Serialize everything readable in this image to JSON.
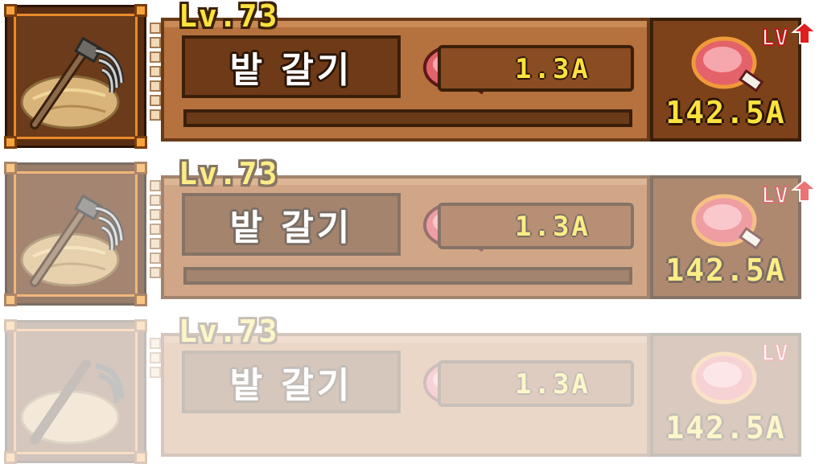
{
  "rows": [
    {
      "level": "Lv.73",
      "name": "밭 갈기",
      "cost": "1.3A",
      "reward": "142.5A",
      "badge": "LV",
      "progress": 0
    },
    {
      "level": "Lv.73",
      "name": "밭 갈기",
      "cost": "1.3A",
      "reward": "142.5A",
      "badge": "LV",
      "progress": 0
    },
    {
      "level": "Lv.73",
      "name": "밭 갈기",
      "cost": "1.3A",
      "reward": "142.5A",
      "badge": "LV",
      "progress": 0
    }
  ],
  "icons": {
    "item": "rake-on-hay-icon",
    "cost": "meat-icon",
    "upgrade": "meat-icon",
    "badge": "level-up-arrow-icon"
  },
  "colors": {
    "accent": "#fbe23d",
    "wood": "#b5713e",
    "frame": "#e98a2a",
    "meat": "#e4626a"
  }
}
